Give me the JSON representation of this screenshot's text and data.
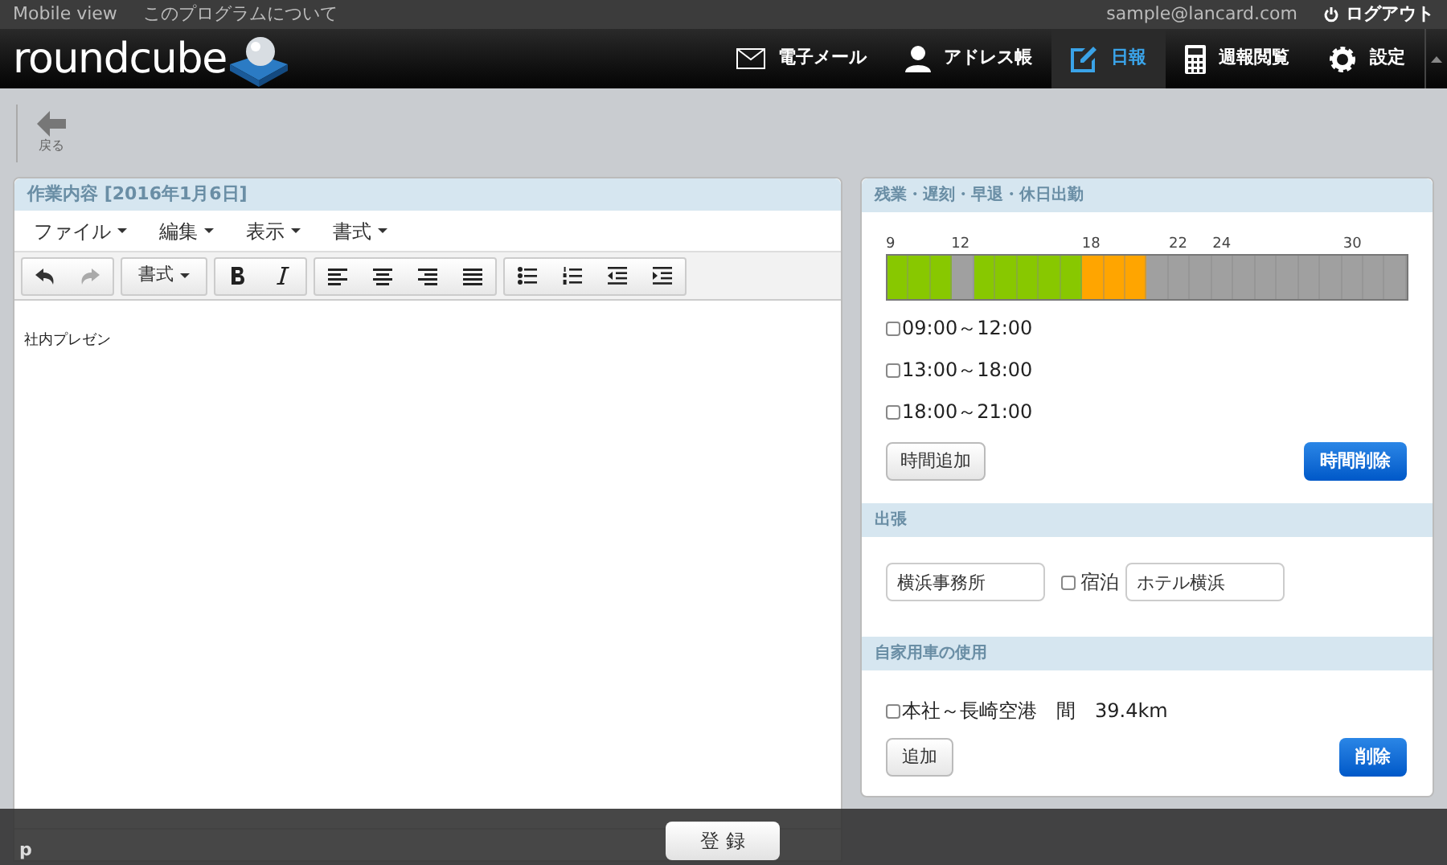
{
  "top_bar": {
    "links": [
      "Mobile view",
      "このプログラムについて"
    ],
    "user": "sample@lancard.com",
    "logout": "ログアウト"
  },
  "header": {
    "logo": "roundcube",
    "nav": [
      {
        "label": "電子メール",
        "kind": "mail",
        "selected": false
      },
      {
        "label": "アドレス帳",
        "kind": "person",
        "selected": false
      },
      {
        "label": "日報",
        "kind": "pen",
        "selected": true
      },
      {
        "label": "週報閲覧",
        "kind": "calc",
        "selected": false
      },
      {
        "label": "設定",
        "kind": "gear",
        "selected": false
      }
    ]
  },
  "toolbar": {
    "back": "戻る"
  },
  "editor_panel": {
    "title": "作業内容 [2016年1月6日]",
    "menus": [
      "ファイル",
      "編集",
      "表示",
      "書式"
    ],
    "format_button": "書式",
    "content": "社内プレゼン",
    "status": "p"
  },
  "overtime": {
    "title": "残業・遅刻・早退・休日出勤",
    "cells": [
      {
        "label": "9",
        "color": "#88c800"
      },
      {
        "color": "#88c800"
      },
      {
        "color": "#88c800"
      },
      {
        "label": "12",
        "color": "#a0a0a0"
      },
      {
        "color": "#88c800"
      },
      {
        "color": "#88c800"
      },
      {
        "color": "#88c800"
      },
      {
        "color": "#88c800"
      },
      {
        "color": "#88c800"
      },
      {
        "label": "18",
        "color": "#ffa500"
      },
      {
        "color": "#ffa500"
      },
      {
        "color": "#ffa500"
      },
      {
        "color": "#a0a0a0"
      },
      {
        "label": "22",
        "color": "#a0a0a0"
      },
      {
        "color": "#a0a0a0"
      },
      {
        "label": "24",
        "color": "#a0a0a0"
      },
      {
        "color": "#a0a0a0"
      },
      {
        "color": "#a0a0a0"
      },
      {
        "color": "#a0a0a0"
      },
      {
        "color": "#a0a0a0"
      },
      {
        "color": "#a0a0a0"
      },
      {
        "label": "30",
        "color": "#a0a0a0"
      },
      {
        "color": "#a0a0a0"
      },
      {
        "color": "#a0a0a0"
      }
    ],
    "slots": [
      {
        "label": "09:00～12:00",
        "checked": false
      },
      {
        "label": "13:00～18:00",
        "checked": false
      },
      {
        "label": "18:00～21:00",
        "checked": false
      }
    ],
    "add_button": "時間追加",
    "delete_button": "時間削除"
  },
  "trip": {
    "title": "出張",
    "place": "横浜事務所",
    "stay": {
      "label": "宿泊",
      "checked": false
    },
    "hotel": "ホテル横浜"
  },
  "car": {
    "title": "自家用車の使用",
    "routes": [
      {
        "label": "本社～長崎空港　間　39.4km",
        "checked": false
      }
    ],
    "add_button": "追加",
    "delete_button": "削除"
  },
  "submit": "登 録"
}
